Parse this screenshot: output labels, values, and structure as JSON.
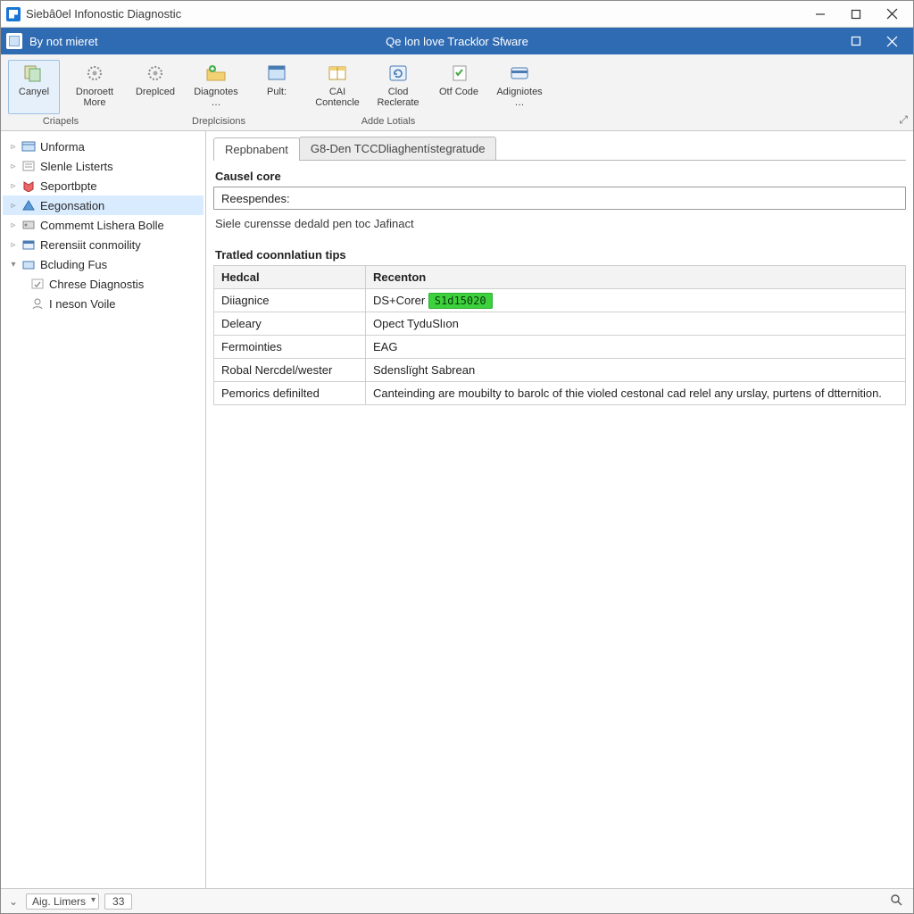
{
  "outer_title": "Siebâ0el Infonostic Diagnostic",
  "inner_title": "By not mieret",
  "inner_center": "Qe lon love Tracklor Sfware",
  "ribbon": {
    "items": [
      {
        "label": "Canyel"
      },
      {
        "label": "Dnoroett More"
      },
      {
        "label": "Dreplced"
      },
      {
        "label": "Diagnotes …"
      },
      {
        "label": "Pult:"
      },
      {
        "label": "CAI Contencle"
      },
      {
        "label": "Clod Reclerate"
      },
      {
        "label": "Otf Code"
      },
      {
        "label": "Adigniotes …"
      }
    ],
    "groups": [
      "Criapels",
      "Dreplcisions",
      "Adde Lotials"
    ]
  },
  "tree": {
    "items": [
      {
        "label": "Unforma"
      },
      {
        "label": "Slenle Listerts"
      },
      {
        "label": "Seportbpte"
      },
      {
        "label": "Eegonsation",
        "selected": true
      },
      {
        "label": "Commemt Lishera Bolle"
      },
      {
        "label": "Rerensiit conmoility"
      },
      {
        "label": "Bcluding Fus",
        "expanded": true,
        "children": [
          {
            "label": "Chrese Diagnostis"
          },
          {
            "label": "I neson Voile"
          }
        ]
      }
    ]
  },
  "tabs": [
    {
      "label": "Repbnabent",
      "active": true
    },
    {
      "label": "G8-Den TCCDliaghentístegratude",
      "active": false
    }
  ],
  "section_causel": "Causel core",
  "respond_label": "Reespendes:",
  "status_line": "Siele curensse dedald pen toc Jafinact",
  "section_tips": "Tratled coonnlatiun tips",
  "table": {
    "headers": [
      "Hedcal",
      "Recenton"
    ],
    "rows": [
      {
        "k": "Diiagnice",
        "v_prefix": "DS+Corer ",
        "v_code": "S1d15020"
      },
      {
        "k": "Deleary",
        "v": "Opect TyduSlıon"
      },
      {
        "k": "Fermointies",
        "v": "EAG"
      },
      {
        "k": "Robal Nercdel/wester",
        "v": "Sdenslïght Sabrean"
      },
      {
        "k": "Pemorics definilted",
        "v": "Canteinding are moubilty to barolc of thie violed cestonal cad relel any urslay, purtens of dtternition."
      }
    ]
  },
  "statusbar": {
    "dropdown": "Aig. Limers",
    "value": "33"
  }
}
